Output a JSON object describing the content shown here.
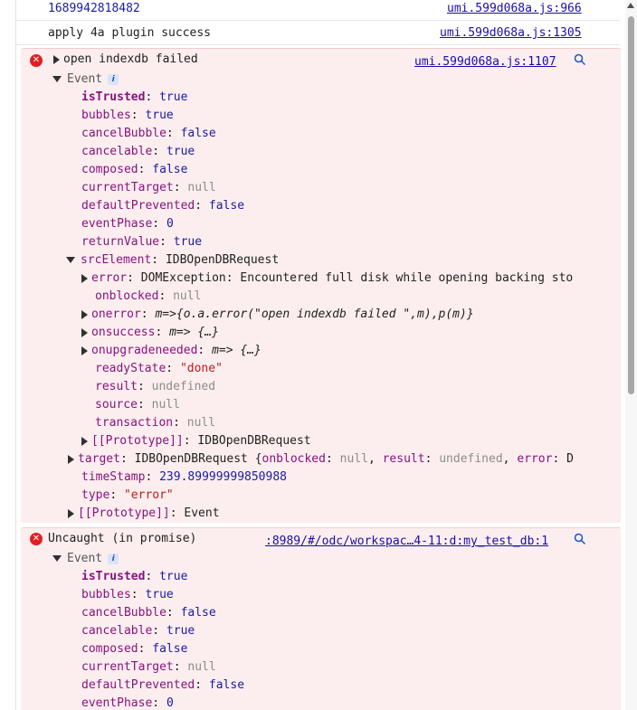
{
  "messages": {
    "m0": {
      "text": "1689942818482",
      "source": "umi.599d068a.js:966"
    },
    "m1": {
      "text": "apply 4a plugin success",
      "source": "umi.599d068a.js:1305"
    }
  },
  "error1": {
    "icon": "error-icon",
    "title": "open indexdb failed",
    "source": "umi.599d068a.js:1107",
    "event_label": "Event",
    "info_badge": "i",
    "props": {
      "isTrusted": {
        "k": "isTrusted",
        "v": "true"
      },
      "bubbles": {
        "k": "bubbles",
        "v": "true"
      },
      "cancelBubble": {
        "k": "cancelBubble",
        "v": "false"
      },
      "cancelable": {
        "k": "cancelable",
        "v": "true"
      },
      "composed": {
        "k": "composed",
        "v": "false"
      },
      "currentTarget": {
        "k": "currentTarget",
        "v": "null"
      },
      "defaultPrevented": {
        "k": "defaultPrevented",
        "v": "false"
      },
      "eventPhase": {
        "k": "eventPhase",
        "v": "0"
      },
      "returnValue": {
        "k": "returnValue",
        "v": "true"
      },
      "srcElement": {
        "k": "srcElement",
        "v": "IDBOpenDBRequest"
      },
      "target": {
        "k": "target",
        "v": "IDBOpenDBRequest"
      },
      "timeStamp": {
        "k": "timeStamp",
        "v": "239.89999999850988"
      },
      "type": {
        "k": "type",
        "v": "\"error\""
      },
      "proto": {
        "k": "[[Prototype]]",
        "v": "Event"
      }
    },
    "src_children": {
      "error": {
        "k": "error",
        "v": "DOMException: Encountered full disk while opening backing sto"
      },
      "onblocked": {
        "k": "onblocked",
        "v": "null"
      },
      "onerror": {
        "k": "onerror",
        "v": "m=>{o.a.error(\"open indexdb failed \",m),p(m)}"
      },
      "onsuccess": {
        "k": "onsuccess",
        "v": "m=> {…}"
      },
      "onupgradeneeded": {
        "k": "onupgradeneeded",
        "v": "m=> {…}"
      },
      "readyState": {
        "k": "readyState",
        "v": "\"done\""
      },
      "result": {
        "k": "result",
        "v": "undefined"
      },
      "source": {
        "k": "source",
        "v": "null"
      },
      "transaction": {
        "k": "transaction",
        "v": "null"
      },
      "proto": {
        "k": "[[Prototype]]",
        "v": "IDBOpenDBRequest"
      }
    },
    "target_summary": {
      "open": "{",
      "k1": "onblocked",
      "v1": "null",
      "k2": "result",
      "v2": "undefined",
      "k3": "error",
      "v3": "D"
    }
  },
  "error2": {
    "icon": "error-icon",
    "title": "Uncaught (in promise)",
    "source": ":8989/#/odc/workspac…4-11:d:my_test_db:1",
    "event_label": "Event",
    "info_badge": "i",
    "props": {
      "isTrusted": {
        "k": "isTrusted",
        "v": "true"
      },
      "bubbles": {
        "k": "bubbles",
        "v": "true"
      },
      "cancelBubble": {
        "k": "cancelBubble",
        "v": "false"
      },
      "cancelable": {
        "k": "cancelable",
        "v": "true"
      },
      "composed": {
        "k": "composed",
        "v": "false"
      },
      "currentTarget": {
        "k": "currentTarget",
        "v": "null"
      },
      "defaultPrevented": {
        "k": "defaultPrevented",
        "v": "false"
      },
      "eventPhase": {
        "k": "eventPhase",
        "v": "0"
      }
    }
  },
  "colors": {
    "error_bg": "#fceeee",
    "error_icon": "#e02020",
    "link": "#1a0dab",
    "key": "#881280",
    "value_blue": "#1a1aa6",
    "string_red": "#c41a16",
    "null_gray": "#8c8c8c"
  }
}
